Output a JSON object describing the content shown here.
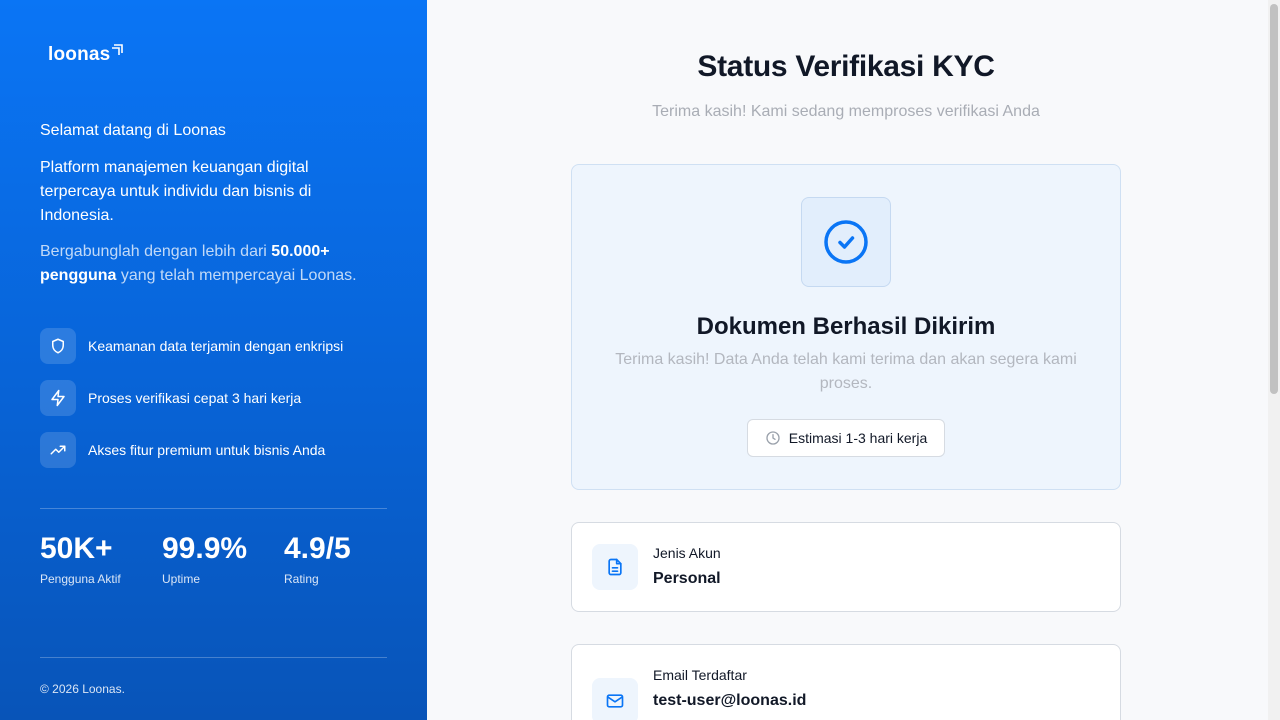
{
  "brand": {
    "name": "loonas",
    "accent": "#0a75f5"
  },
  "sidebar": {
    "welcome": "Selamat datang di Loonas",
    "description": "Platform manajemen keuangan digital terpercaya untuk individu dan bisnis di Indonesia.",
    "join_prefix": "Bergabunglah dengan lebih dari ",
    "join_highlight": "50.000+ pengguna",
    "join_suffix": " yang telah mempercayai Loonas.",
    "features": [
      {
        "icon": "shield-icon",
        "label": "Keamanan data terjamin dengan enkripsi"
      },
      {
        "icon": "lightning-icon",
        "label": "Proses verifikasi cepat 3 hari kerja"
      },
      {
        "icon": "trending-up-icon",
        "label": "Akses fitur premium untuk bisnis Anda"
      }
    ],
    "stats": [
      {
        "value": "50K+",
        "label": "Pengguna Aktif"
      },
      {
        "value": "99.9%",
        "label": "Uptime"
      },
      {
        "value": "4.9/5",
        "label": "Rating"
      }
    ],
    "copyright": "© 2026 Loonas."
  },
  "main": {
    "title": "Status Verifikasi KYC",
    "subtitle": "Terima kasih! Kami sedang memproses verifikasi Anda",
    "status": {
      "title": "Dokumen Berhasil Dikirim",
      "description": "Terima kasih! Data Anda telah kami terima dan akan segera kami proses.",
      "estimate": "Estimasi 1-3 hari kerja"
    },
    "info": [
      {
        "icon": "document-icon",
        "label": "Jenis Akun",
        "value": "Personal"
      },
      {
        "icon": "mail-icon",
        "label": "Email Terdaftar",
        "value": "test-user@loonas.id"
      }
    ]
  }
}
